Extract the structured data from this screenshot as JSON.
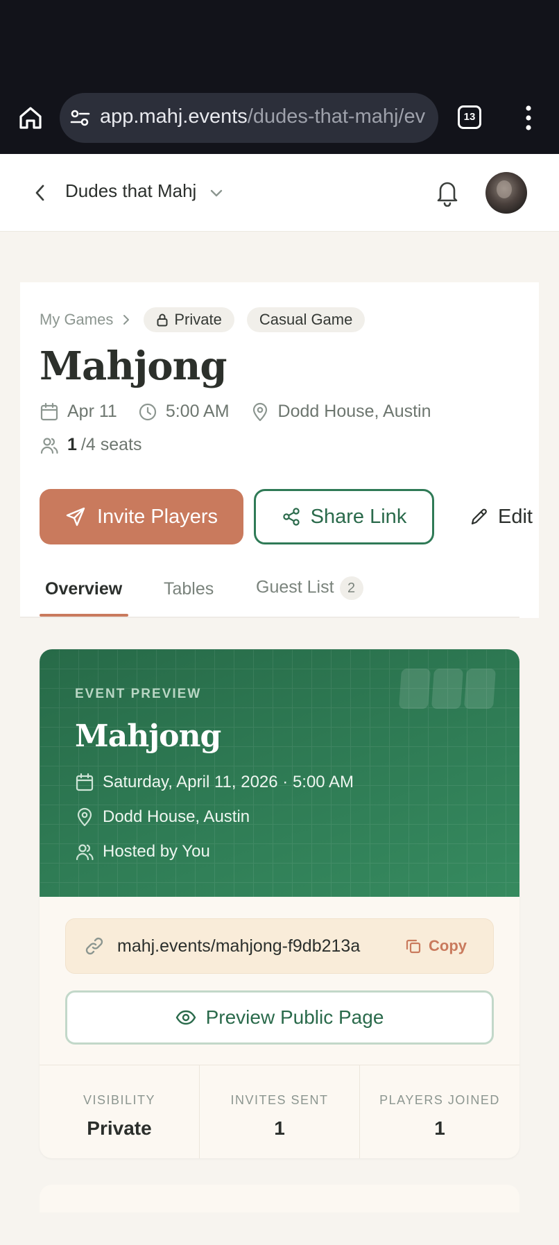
{
  "browser": {
    "url_host": "app.mahj.events",
    "url_path": "/dudes-that-mahj/ev",
    "tab_count": "13"
  },
  "header": {
    "group_name": "Dudes that Mahj"
  },
  "event": {
    "breadcrumb": "My Games",
    "visibility_badge": "Private",
    "type_badge": "Casual Game",
    "title": "Mahjong",
    "date": "Apr 11",
    "time": "5:00 AM",
    "location": "Dodd House, Austin",
    "seats_taken": "1",
    "seats_total": "/4 seats"
  },
  "actions": {
    "invite": "Invite Players",
    "share": "Share Link",
    "edit": "Edit"
  },
  "tabs": [
    {
      "label": "Overview"
    },
    {
      "label": "Tables"
    },
    {
      "label": "Guest List",
      "count": "2"
    }
  ],
  "preview": {
    "eyebrow": "EVENT PREVIEW",
    "title": "Mahjong",
    "datetime": "Saturday, April 11, 2026 · 5:00 AM",
    "location": "Dodd House, Austin",
    "host": "Hosted by You",
    "link": "mahj.events/mahjong-f9db213a",
    "copy_label": "Copy",
    "preview_button": "Preview Public Page"
  },
  "stats": [
    {
      "label": "VISIBILITY",
      "value": "Private"
    },
    {
      "label": "INVITES SENT",
      "value": "1"
    },
    {
      "label": "PLAYERS JOINED",
      "value": "1"
    }
  ],
  "colors": {
    "accent": "#c97a5d",
    "brand_green": "#2f7a56",
    "background": "#f7f4ef"
  }
}
